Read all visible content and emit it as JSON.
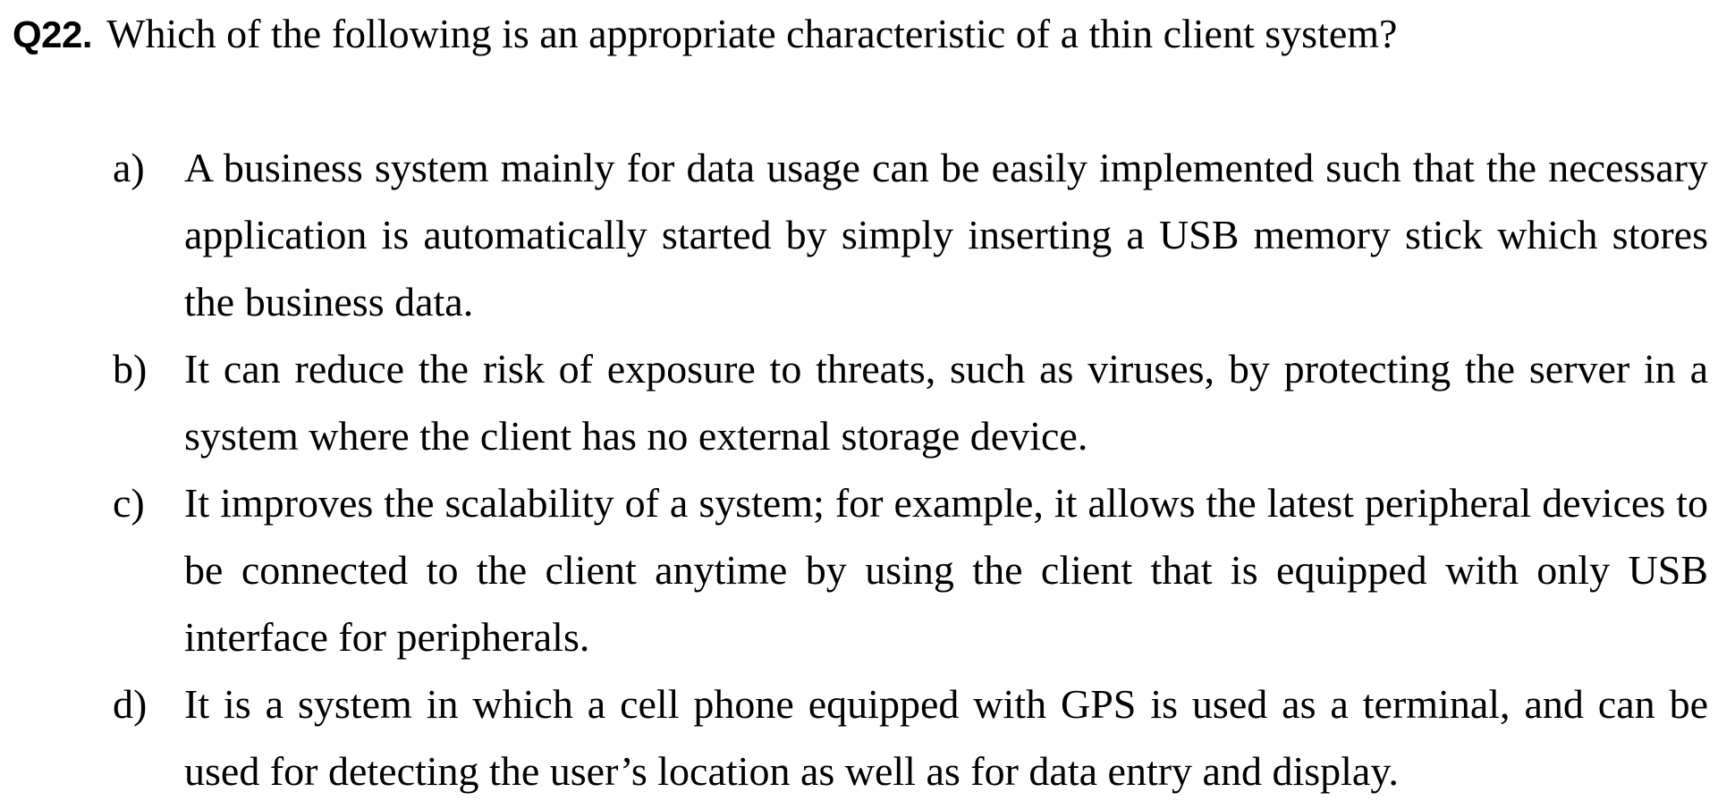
{
  "question": {
    "number": "Q22.",
    "text": "Which of the following is an appropriate characteristic of a thin client system?"
  },
  "options": [
    {
      "letter": "a)",
      "text": "A business system mainly for data usage can be easily implemented such that the necessary application is automatically started by simply inserting a USB memory stick which stores the business data."
    },
    {
      "letter": "b)",
      "text": "It can reduce the risk of exposure to threats, such as viruses, by protecting the server in a system where the client has no external storage device."
    },
    {
      "letter": "c)",
      "text": "It improves the scalability of a system; for example, it allows the latest peripheral devices to be connected to the client anytime by using the client that is equipped with only USB interface for peripherals."
    },
    {
      "letter": "d)",
      "text": "It is a system in which a cell phone equipped with GPS is used as a terminal, and can be used for detecting the user’s location as well as for data entry and display."
    }
  ]
}
